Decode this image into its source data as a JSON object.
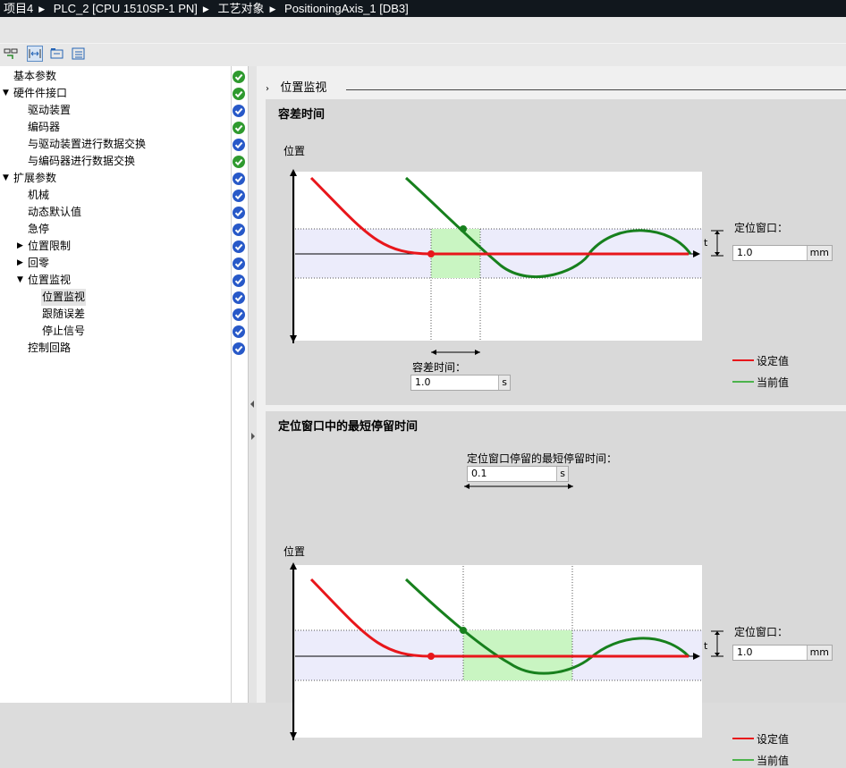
{
  "breadcrumb": [
    "项目4",
    "PLC_2 [CPU 1510SP-1 PN]",
    "工艺对象",
    "PositioningAxis_1 [DB3]"
  ],
  "tree": [
    {
      "label": "基本参数",
      "status": "green",
      "indent": 0,
      "arrow": ""
    },
    {
      "label": "硬件件接口",
      "status": "green",
      "indent": 0,
      "arrow": "down"
    },
    {
      "label": "驱动装置",
      "status": "blue",
      "indent": 1,
      "arrow": ""
    },
    {
      "label": "编码器",
      "status": "green",
      "indent": 1,
      "arrow": ""
    },
    {
      "label": "与驱动装置进行数据交换",
      "status": "blue",
      "indent": 1,
      "arrow": ""
    },
    {
      "label": "与编码器进行数据交换",
      "status": "green",
      "indent": 1,
      "arrow": ""
    },
    {
      "label": "扩展参数",
      "status": "blue",
      "indent": 0,
      "arrow": "down"
    },
    {
      "label": "机械",
      "status": "blue",
      "indent": 1,
      "arrow": ""
    },
    {
      "label": "动态默认值",
      "status": "blue",
      "indent": 1,
      "arrow": ""
    },
    {
      "label": "急停",
      "status": "blue",
      "indent": 1,
      "arrow": ""
    },
    {
      "label": "位置限制",
      "status": "blue",
      "indent": 1,
      "arrow": "right"
    },
    {
      "label": "回零",
      "status": "blue",
      "indent": 1,
      "arrow": "right"
    },
    {
      "label": "位置监视",
      "status": "blue",
      "indent": 1,
      "arrow": "down"
    },
    {
      "label": "位置监视",
      "status": "blue",
      "indent": 2,
      "arrow": "",
      "selected": true
    },
    {
      "label": "跟随误差",
      "status": "blue",
      "indent": 2,
      "arrow": ""
    },
    {
      "label": "停止信号",
      "status": "blue",
      "indent": 2,
      "arrow": ""
    },
    {
      "label": "控制回路",
      "status": "blue",
      "indent": 1,
      "arrow": ""
    }
  ],
  "section_title": "位置监视",
  "panel1": {
    "title": "容差时间",
    "y_axis_label": "位置",
    "window_label": "定位窗口：",
    "window_value": "1.0",
    "window_unit": "mm",
    "t_label": "t",
    "tolerance_label": "容差时间：",
    "tolerance_value": "1.0",
    "tolerance_unit": "s",
    "legend_setpoint": "设定值",
    "legend_actual": "当前值"
  },
  "panel2": {
    "title": "定位窗口中的最短停留时间",
    "y_axis_label": "位置",
    "dwell_label": "定位窗口停留的最短停留时间：",
    "dwell_value": "0.1",
    "dwell_unit": "s",
    "window_label": "定位窗口：",
    "window_value": "1.0",
    "window_unit": "mm",
    "t_label": "t",
    "legend_setpoint": "设定值",
    "legend_actual": "当前值"
  },
  "colors": {
    "setpoint": "#e8161b",
    "actual": "#17801d",
    "check_green": "#2f9a2f",
    "check_blue": "#2859c8",
    "window_band": "#ececfb",
    "tolerance_zone": "#c9f5c2"
  }
}
